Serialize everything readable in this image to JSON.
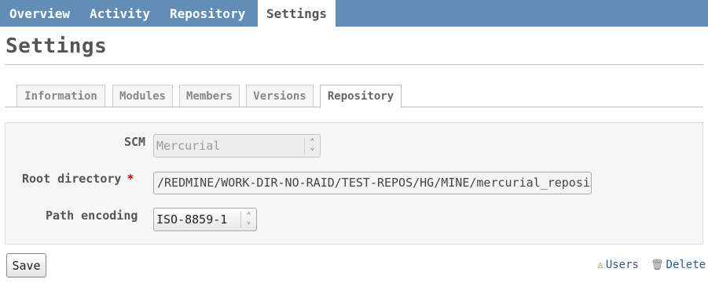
{
  "nav": {
    "tabs": [
      {
        "label": "Overview"
      },
      {
        "label": "Activity"
      },
      {
        "label": "Repository"
      },
      {
        "label": "Settings",
        "active": true
      }
    ]
  },
  "page": {
    "title": "Settings"
  },
  "settings_tabs": [
    {
      "label": "Information"
    },
    {
      "label": "Modules"
    },
    {
      "label": "Members"
    },
    {
      "label": "Versions"
    },
    {
      "label": "Repository",
      "active": true
    }
  ],
  "form": {
    "scm": {
      "label": "SCM",
      "value": "Mercurial",
      "disabled": true
    },
    "root_directory": {
      "label": "Root directory",
      "required_marker": "*",
      "value": "/REDMINE/WORK-DIR-NO-RAID/TEST-REPOS/HG/MINE/mercurial_reposi"
    },
    "path_encoding": {
      "label": "Path encoding",
      "value": "ISO-8859-1"
    }
  },
  "actions": {
    "save_label": "Save",
    "users_label": "Users",
    "delete_label": "Delete"
  },
  "icons": {
    "users": "users-icon",
    "delete": "trash-icon",
    "select_arrow": "up-down-chevron-icon"
  },
  "colors": {
    "nav_bg": "#628db6",
    "required": "#cc0000",
    "link": "#2a5a8a"
  }
}
